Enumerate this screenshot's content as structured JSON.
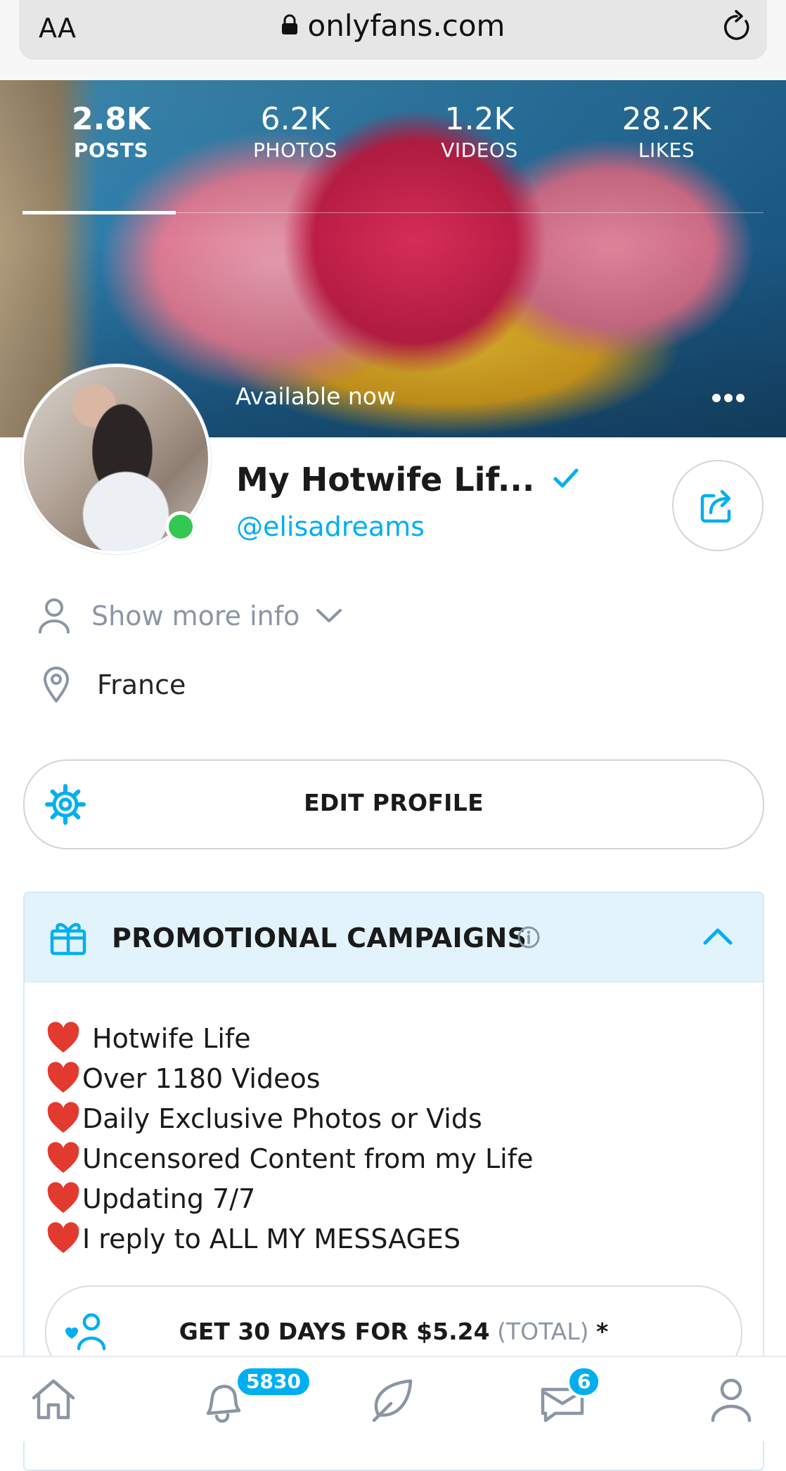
{
  "browser": {
    "aa_label": "AA",
    "url": "onlyfans.com"
  },
  "stats": [
    {
      "value": "2.8K",
      "label": "POSTS"
    },
    {
      "value": "6.2K",
      "label": "PHOTOS"
    },
    {
      "value": "1.2K",
      "label": "VIDEOS"
    },
    {
      "value": "28.2K",
      "label": "LIKES"
    }
  ],
  "banner": {
    "status": "Available now"
  },
  "profile": {
    "name": "My Hotwife Lif...",
    "username": "@elisadreams",
    "show_more_info": "Show more info",
    "location": "France",
    "edit_profile": "EDIT PROFILE"
  },
  "promo": {
    "title": "PROMOTIONAL CAMPAIGNS",
    "lines": [
      "Hotwife Life",
      "Over 1180 Videos",
      "Daily Exclusive Photos or Vids",
      "Uncensored Content from my Life",
      "Updating 7/7",
      "I reply to ALL MY MESSAGES"
    ],
    "subscribe_main": "GET 30 DAYS FOR $5.24",
    "subscribe_total": "(TOTAL)",
    "subscribe_star": "*"
  },
  "nav": {
    "notifications_badge": "5830",
    "messages_badge": "6"
  },
  "colors": {
    "accent": "#00aff0",
    "online": "#32c851",
    "heart": "#e23a2e"
  }
}
